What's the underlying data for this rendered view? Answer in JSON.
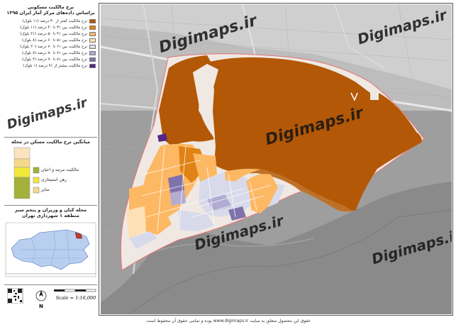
{
  "legend": {
    "title_line1": "نرخ مالکیت مسکونی",
    "title_line2": "براساس داده‌های مرکز آمار ایران ۱۳۹۵",
    "items": [
      {
        "label": "نرخ مالکیت کمتر از ۳۰ درصد (۱۱ بلوک)",
        "color": "#b35806"
      },
      {
        "label": "نرخ مالکیت بین ۳۱ تا ۴۰ درصد (۱۱ بلوک)",
        "color": "#e08214"
      },
      {
        "label": "نرخ مالکیت بین ۴۱ تا ۵۰ درصد (۲۱ بلوک)",
        "color": "#fdb863"
      },
      {
        "label": "نرخ مالکیت بین ۵۱ تا ۶۰ درصد (۸ بلوک)",
        "color": "#fee0b6"
      },
      {
        "label": "نرخ مالکیت بین ۶۱ تا ۷۰ درصد (۲۰ بلوک)",
        "color": "#d8daeb"
      },
      {
        "label": "نرخ مالکیت بین ۷۱ تا ۸۰ درصد (۸ بلوک)",
        "color": "#b2abd2"
      },
      {
        "label": "نرخ مالکیت بین ۸۱ تا ۹۰ درصد (۴ بلوک)",
        "color": "#8073ac"
      },
      {
        "label": "نرخ مالکیت بیشتر از ۹۱ درصد (۱ بلوک)",
        "color": "#542788"
      }
    ]
  },
  "neighborhood_chart": {
    "title": "میانگین نرخ مالکیت مسکن در محله",
    "items": [
      {
        "label": "مالکیت مرتبه و اعیان",
        "color": "#a3b03a"
      },
      {
        "label": "رهن استیجاری",
        "color": "#f2e83a"
      },
      {
        "label": "سایر",
        "color": "#f5d88a"
      }
    ]
  },
  "locator": {
    "title_line1": "محله کیان و وزیران و پنجم سبز",
    "title_line2": "منطقه ۱ شهرداری تهران"
  },
  "scale_text": "Scale = 1:16,000",
  "north_label": "N",
  "watermark": "Digimaps.ir",
  "footer_text": "حقوق این محصول متعلق به سایت www.digimaps.ir بوده و تمامی حقوق آن محفوظ است."
}
